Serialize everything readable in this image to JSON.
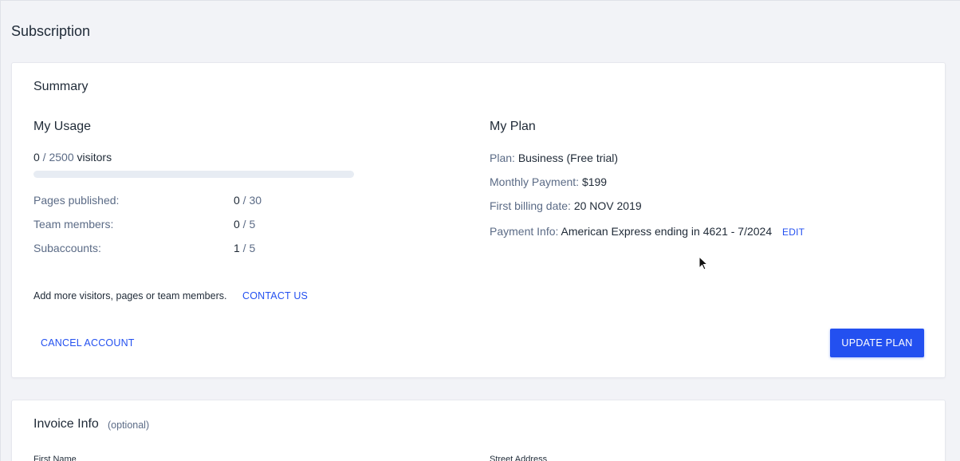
{
  "page": {
    "title": "Subscription"
  },
  "summary": {
    "title": "Summary",
    "usage": {
      "title": "My Usage",
      "visitors_used": "0",
      "visitors_separator": " / ",
      "visitors_limit": "2500",
      "visitors_suffix": " visitors",
      "visitors_fraction": 0,
      "stats": [
        {
          "label": "Pages published:",
          "used": "0",
          "total": " / 30"
        },
        {
          "label": "Team members:",
          "used": "0",
          "total": " / 5"
        },
        {
          "label": "Subaccounts:",
          "used": "1",
          "total": " / 5"
        }
      ],
      "add_more_text": "Add more visitors, pages or team members.",
      "contact_label": "CONTACT US",
      "cancel_label": "CANCEL ACCOUNT"
    },
    "plan": {
      "title": "My Plan",
      "rows": [
        {
          "label": "Plan:",
          "value": "Business (Free trial)"
        },
        {
          "label": "Monthly Payment:",
          "value": "$199"
        },
        {
          "label": "First billing date:",
          "value": "20 NOV 2019"
        },
        {
          "label": "Payment Info:",
          "value": "American Express ending in 4621 - 7/2024"
        }
      ],
      "edit_label": "EDIT",
      "update_label": "UPDATE PLAN"
    }
  },
  "invoice": {
    "title": "Invoice Info",
    "optional_label": "(optional)",
    "first_name_label": "First Name",
    "street_address_label": "Street Address"
  },
  "colors": {
    "accent": "#2350f0",
    "background": "#f2f3f7",
    "text_primary": "#1f2a37",
    "text_muted": "#5b6b86"
  },
  "icons": {
    "cursor": "mouse-pointer-icon"
  }
}
